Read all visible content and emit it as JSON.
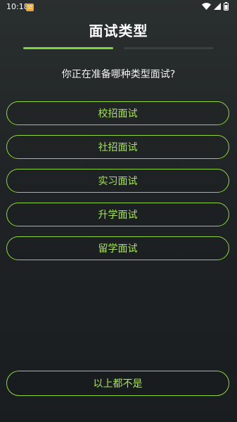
{
  "status": {
    "time": "10:18"
  },
  "header": {
    "title": "面试类型"
  },
  "progress": {
    "value": 0.5
  },
  "question": "你正在准备哪种类型面试?",
  "options": [
    "校招面试",
    "社招面试",
    "实习面试",
    "升学面试",
    "留学面试"
  ],
  "bottom_option": "以上都不是",
  "colors": {
    "accent": "#8fd63b",
    "progress": "#7fd63b",
    "background": "#1f2325"
  }
}
